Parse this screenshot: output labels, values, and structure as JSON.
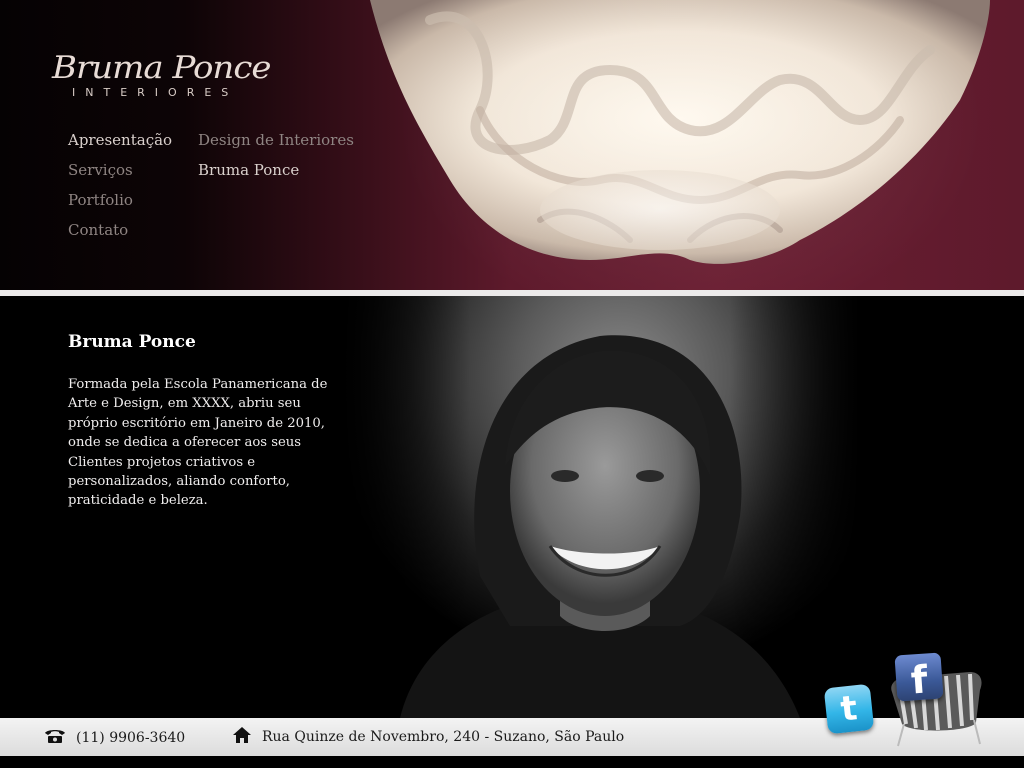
{
  "logo": {
    "script": "Bruma Ponce",
    "subtitle": "INTERIORES"
  },
  "menu": {
    "main": [
      {
        "label": "Apresentação",
        "active": true
      },
      {
        "label": "Serviços",
        "active": false
      },
      {
        "label": "Portfolio",
        "active": false
      },
      {
        "label": "Contato",
        "active": false
      }
    ],
    "sub": [
      {
        "label": "Design de Interiores",
        "active": false
      },
      {
        "label": "Bruma Ponce",
        "active": true
      }
    ]
  },
  "about": {
    "title": "Bruma Ponce",
    "text": "Formada pela Escola Panamericana de Arte e Design, em XXXX, abriu seu próprio escritório em Janeiro de 2010, onde se dedica a oferecer aos seus Clientes projetos criativos e personalizados, aliando conforto, praticidade e beleza."
  },
  "footer": {
    "phone": "(11) 9906-3640",
    "address": "Rua Quinze de Novembro, 240 - Suzano, São Paulo"
  },
  "social": {
    "twitter_glyph": "t",
    "facebook_glyph": "f"
  },
  "icons": {
    "phone": "phone-icon",
    "address": "home-icon",
    "twitter": "twitter-icon",
    "facebook": "facebook-icon"
  },
  "colors": {
    "header_bg": "#6a1e32",
    "text_light": "#d9d0cc",
    "text_dim": "#8f8583",
    "footer_bg": "#e4e4e4",
    "twitter": "#33b6e8",
    "facebook": "#3b5998"
  }
}
